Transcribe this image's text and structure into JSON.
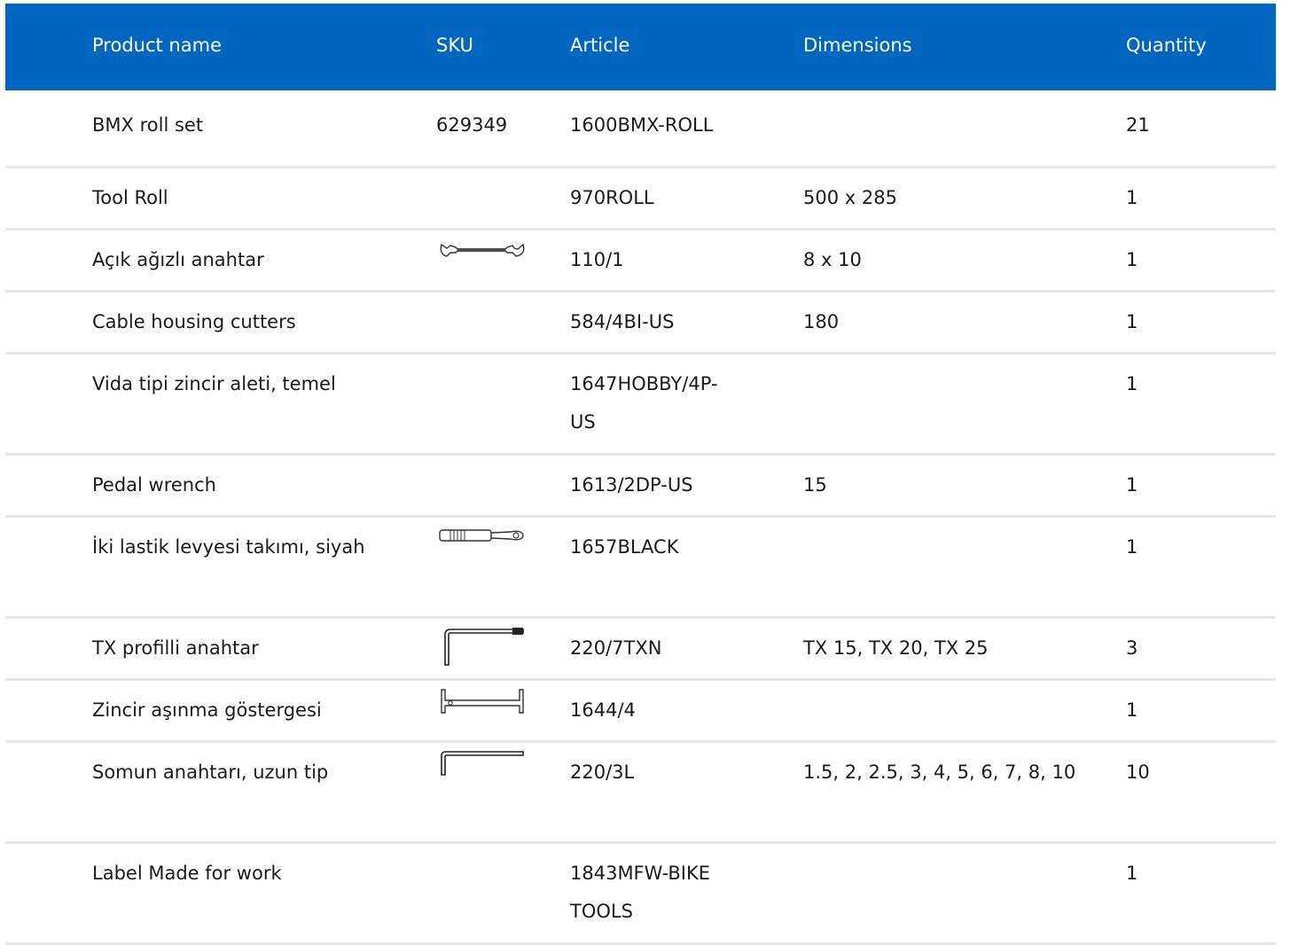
{
  "table": {
    "headers": {
      "name": "Product name",
      "sku": "SKU",
      "article": "Article",
      "dimensions": "Dimensions",
      "quantity": "Quantity"
    },
    "rows": [
      {
        "name": "BMX roll set",
        "sku": "629349",
        "article": "1600BMX-ROLL",
        "dimensions": "",
        "quantity": "21",
        "icon": ""
      },
      {
        "name": "Tool Roll",
        "sku": "",
        "article": "970ROLL",
        "dimensions": "500 x 285",
        "quantity": "1",
        "icon": ""
      },
      {
        "name": "Açık ağızlı anahtar",
        "sku": "",
        "article": "110/1",
        "dimensions": "8 x 10",
        "quantity": "1",
        "icon": "open-end-wrench-icon"
      },
      {
        "name": "Cable housing cutters",
        "sku": "",
        "article": "584/4BI-US",
        "dimensions": "180",
        "quantity": "1",
        "icon": ""
      },
      {
        "name": "Vida tipi zincir aleti, temel",
        "sku": "",
        "article": "1647HOBBY/4P-US",
        "dimensions": "",
        "quantity": "1",
        "icon": ""
      },
      {
        "name": "Pedal wrench",
        "sku": "",
        "article": "1613/2DP-US",
        "dimensions": "15",
        "quantity": "1",
        "icon": ""
      },
      {
        "name": "İki lastik levyesi takımı, siyah",
        "sku": "",
        "article": "1657BLACK",
        "dimensions": "",
        "quantity": "1",
        "icon": "tire-lever-icon"
      },
      {
        "name": "TX profilli anahtar",
        "sku": "",
        "article": "220/7TXN",
        "dimensions": "TX 15, TX 20, TX 25",
        "quantity": "3",
        "icon": "torx-key-icon"
      },
      {
        "name": "Zincir aşınma göstergesi",
        "sku": "",
        "article": "1644/4",
        "dimensions": "",
        "quantity": "1",
        "icon": "chain-wear-gauge-icon"
      },
      {
        "name": "Somun anahtarı, uzun tip",
        "sku": "",
        "article": "220/3L",
        "dimensions": "1.5, 2, 2.5, 3, 4, 5, 6, 7, 8, 10",
        "quantity": "10",
        "icon": "hex-key-icon"
      },
      {
        "name": "Label Made for work",
        "sku": "",
        "article": "1843MFW-BIKE TOOLS",
        "dimensions": "",
        "quantity": "1",
        "icon": ""
      }
    ]
  },
  "colors": {
    "header_bg": "#0066c0",
    "header_text": "#ffffff",
    "divider": "#e6e6e6"
  }
}
